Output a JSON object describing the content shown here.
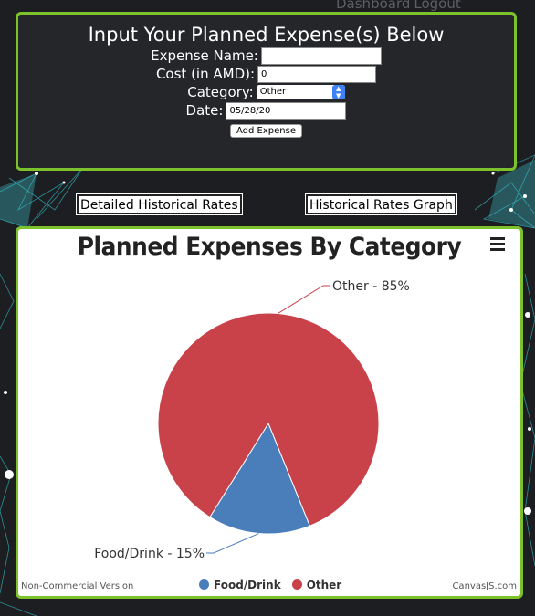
{
  "nav": {
    "dashboard": "Dashboard",
    "logout": "Logout"
  },
  "form": {
    "title": "Input Your Planned Expense(s) Below",
    "expense_name_label": "Expense Name:",
    "expense_name_value": "",
    "cost_label": "Cost (in AMD):",
    "cost_value": "0",
    "category_label": "Category:",
    "category_value": "Other",
    "date_label": "Date:",
    "date_value": "05/28/20",
    "add_button": "Add Expense"
  },
  "links": {
    "detailed_rates": "Detailed Historical Rates",
    "rates_graph": "Historical Rates Graph"
  },
  "chart_data": {
    "type": "pie",
    "title": "Planned Expenses By Category",
    "slices": [
      {
        "name": "Food/Drink",
        "percent": 15,
        "label": "Food/Drink - 15%",
        "color": "#4a7ebb"
      },
      {
        "name": "Other",
        "percent": 85,
        "label": "Other - 85%",
        "color": "#c9424a"
      }
    ],
    "legend": {
      "position": "bottom",
      "items": [
        "Food/Drink",
        "Other"
      ]
    },
    "watermark_left": "Non-Commercial Version",
    "watermark_right": "CanvasJS.com"
  },
  "colors": {
    "accent": "#7dc12d",
    "background": "#1d1e22",
    "network": "#3ec3cb"
  }
}
